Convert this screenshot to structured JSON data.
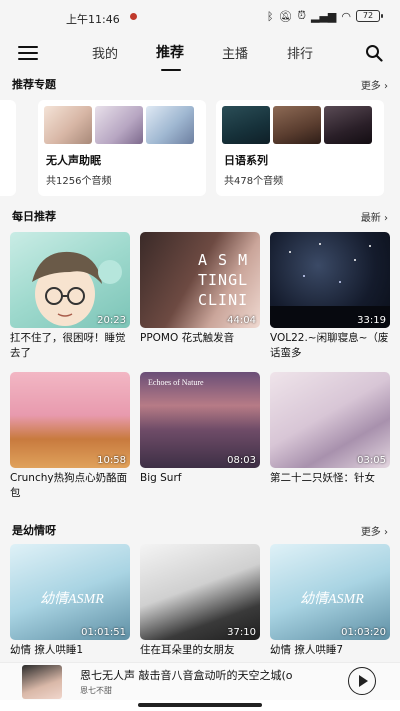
{
  "status_bar": {
    "time": "上午11:46",
    "icons": [
      "bluetooth-icon",
      "mute-icon",
      "alarm-icon",
      "signal-icon",
      "wifi-icon"
    ],
    "battery": "72"
  },
  "nav": {
    "tabs": [
      "我的",
      "推荐",
      "主播",
      "排行"
    ],
    "active_tab": "推荐"
  },
  "topics": {
    "title": "推荐专题",
    "more": "更多",
    "cards": [
      {
        "name": "无人声助眠",
        "count": "共1256个音频"
      },
      {
        "name": "日语系列",
        "count": "共478个音频"
      }
    ]
  },
  "daily": {
    "title": "每日推荐",
    "more": "最新",
    "videos": [
      {
        "title": "扛不住了，很困呀！睡觉去了",
        "duration": "20:23",
        "thumb_text": ""
      },
      {
        "title": "PPOMO 花式触发音",
        "duration": "44:04",
        "thumb_text": "A S M\nTINGL\nCLINI"
      },
      {
        "title": "VOL22.~闲聊寝息~（废话蛮多",
        "duration": "33:19",
        "thumb_text": ""
      },
      {
        "title": "Crunchy热狗点心奶酪面包",
        "duration": "10:58",
        "thumb_text": ""
      },
      {
        "title": "Big Surf",
        "duration": "08:03",
        "thumb_text": "Echoes of Nature"
      },
      {
        "title": "第二十二只妖怪：针女",
        "duration": "03:05",
        "thumb_text": ""
      }
    ]
  },
  "youqing": {
    "title": "是幼情呀",
    "more": "更多",
    "videos": [
      {
        "title": "幼情 撩人哄睡1",
        "duration": "01:01:51",
        "thumb_text": "幼情ASMR"
      },
      {
        "title": "住在耳朵里的女朋友",
        "duration": "37:10",
        "thumb_text": ""
      },
      {
        "title": "幼情 撩人哄睡7",
        "duration": "01:03:20",
        "thumb_text": "幼情ASMR"
      }
    ]
  },
  "player": {
    "title": "恩七无人声 敲击音八音盒动听的天空之城(o",
    "artist": "恩七不甜"
  },
  "colors": {
    "background": "#f5f5f5",
    "card": "#ffffff",
    "text": "#111111"
  }
}
